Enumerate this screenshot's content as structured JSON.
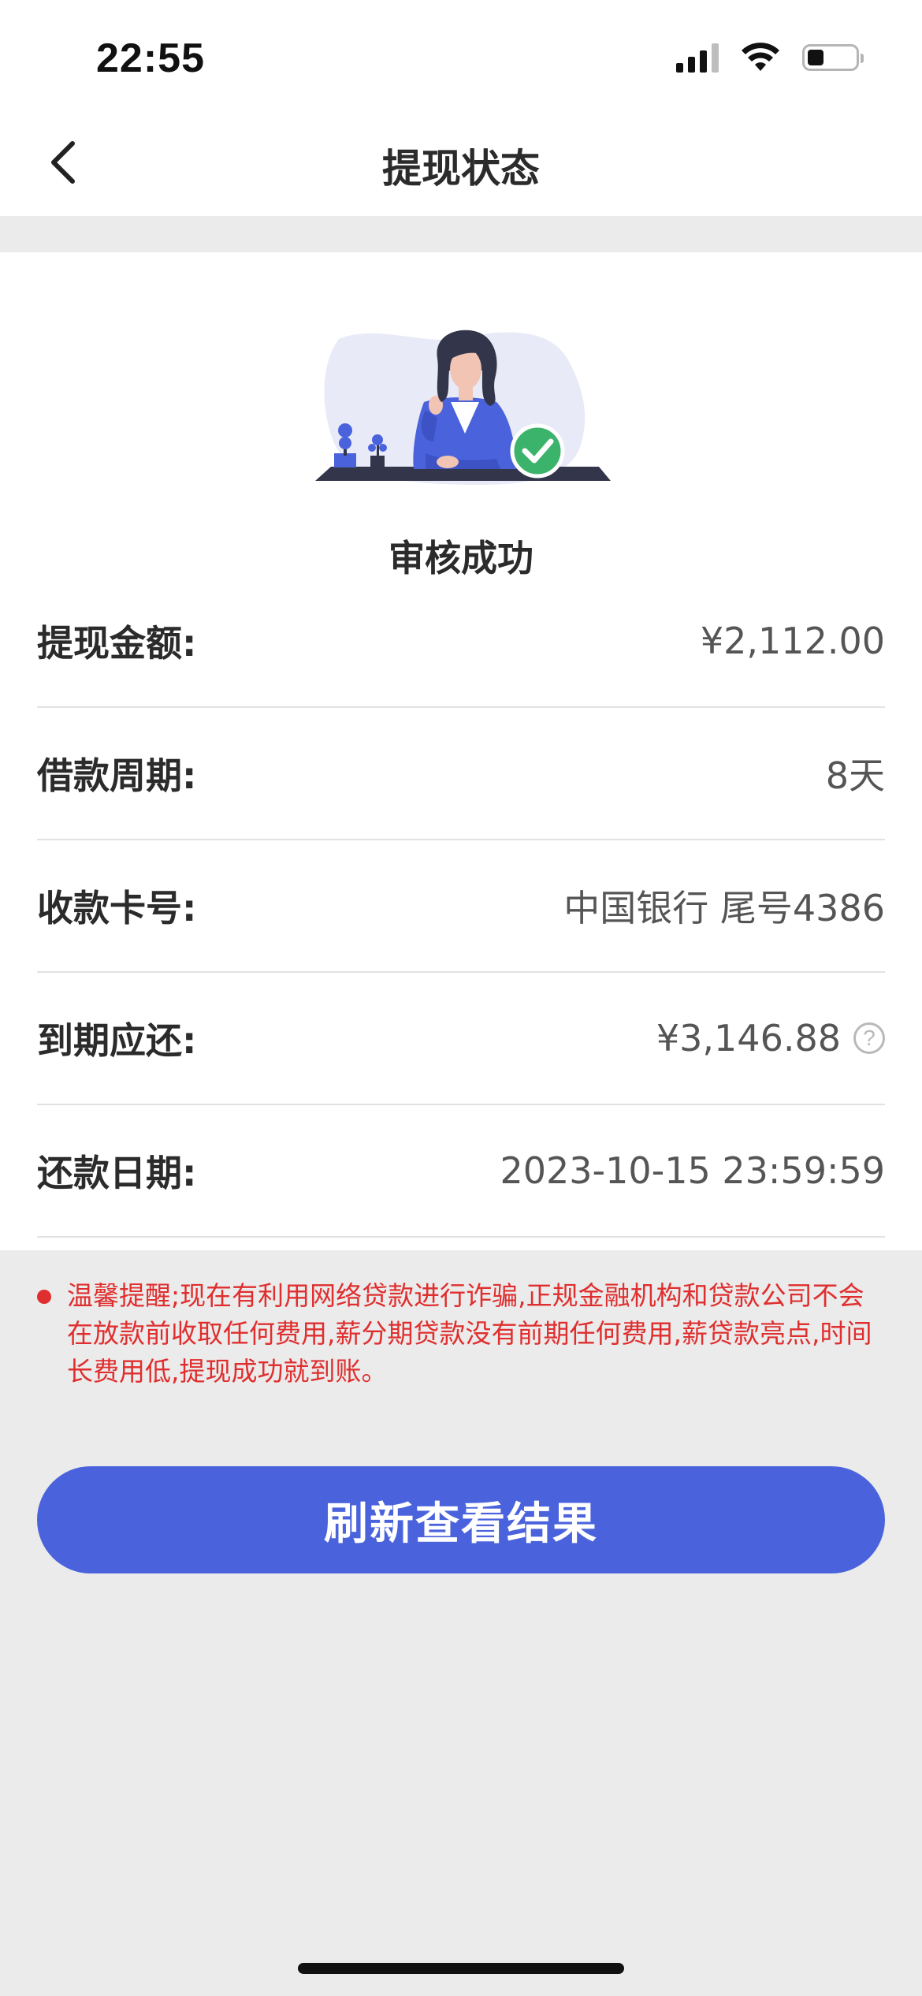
{
  "status_bar": {
    "time": "22:55"
  },
  "nav": {
    "title": "提现状态"
  },
  "status": {
    "title": "审核成功"
  },
  "details": [
    {
      "label": "提现金额:",
      "value": "¥2,112.00"
    },
    {
      "label": "借款周期:",
      "value": "8天"
    },
    {
      "label": "收款卡号:",
      "value": "中国银行 尾号4386"
    },
    {
      "label": "到期应还:",
      "value": "¥3,146.88"
    },
    {
      "label": "还款日期:",
      "value": "2023-10-15 23:59:59"
    }
  ],
  "notice": {
    "text": "温馨提醒;现在有利用网络贷款进行诈骗,正规金融机构和贷款公司不会在放款前收取任何费用,薪分期贷款没有前期任何费用,薪贷款亮点,时间长费用低,提现成功就到账。"
  },
  "actions": {
    "refresh_label": "刷新查看结果"
  },
  "colors": {
    "accent": "#4a63dc",
    "success": "#3bb36b",
    "warning_text": "#e02e2e"
  }
}
